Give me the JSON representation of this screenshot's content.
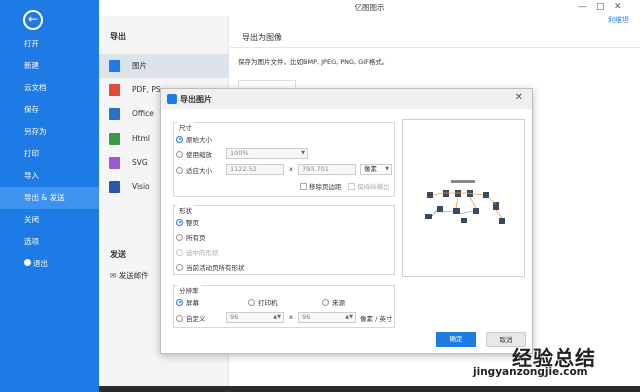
{
  "app": {
    "title": "亿图图示",
    "user": "利维坦"
  },
  "sidebar": {
    "items": [
      {
        "label": "打开"
      },
      {
        "label": "新建"
      },
      {
        "label": "云文档"
      },
      {
        "label": "保存"
      },
      {
        "label": "另存为"
      },
      {
        "label": "打印"
      },
      {
        "label": "导入"
      },
      {
        "label": "导出 & 发送"
      },
      {
        "label": "关闭"
      },
      {
        "label": "选项"
      },
      {
        "label": "退出"
      }
    ]
  },
  "export": {
    "heading": "导出",
    "items": [
      {
        "label": "图片",
        "color": "#1e7be6"
      },
      {
        "label": "PDF, PS,",
        "color": "#e04a3a"
      },
      {
        "label": "Office",
        "color": "#2a6fc9"
      },
      {
        "label": "Html",
        "color": "#3a9a4a"
      },
      {
        "label": "SVG",
        "color": "#9a5ad0"
      },
      {
        "label": "Visio",
        "color": "#2a55a8"
      }
    ],
    "send_heading": "发送",
    "send_mail": "发送邮件"
  },
  "right": {
    "title": "导出为图像",
    "desc": "保存为图片文件，比如BMP, JPEG, PNG, GIF格式。"
  },
  "dialog": {
    "title": "导出图片",
    "size": {
      "title": "尺寸",
      "original": "原始大小",
      "zoom": "使用缩放",
      "zoom_value": "100%",
      "fit": "适应大小",
      "width": "1122.52",
      "times": "x",
      "height": "793.701",
      "unit": "像素",
      "remove_margin": "移除页边距",
      "keep_ratio": "保持纵横比"
    },
    "shape": {
      "title": "形状",
      "page": "整页",
      "all": "所有页",
      "selected": "选中的形状",
      "current_all": "当前活动页所有形状"
    },
    "resolution": {
      "title": "分辨率",
      "screen": "屏幕",
      "printer": "打印机",
      "source": "来源",
      "custom": "自定义",
      "x": "96",
      "times": "x",
      "y": "96",
      "unit": "像素 / 英寸"
    },
    "ok": "确定",
    "cancel": "取消"
  },
  "watermark": {
    "cn": "经验总结",
    "url": "jingyanzongjie.com"
  }
}
